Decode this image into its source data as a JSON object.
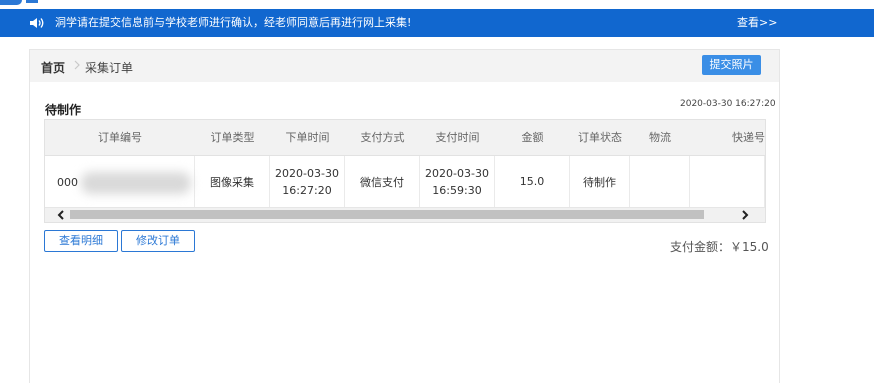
{
  "notice": {
    "message": "洞学请在提交信息前与学校老师进行确认，经老师同意后再进行网上采集!",
    "view_link": "查看>>"
  },
  "breadcrumb": {
    "home": "首页",
    "current": "采集订单"
  },
  "actions": {
    "submit_photo": "提交照片",
    "view_detail": "查看明细",
    "modify_order": "修改订单"
  },
  "order": {
    "status_title": "待制作",
    "timestamp": "2020-03-30 16:27:20",
    "columns": [
      "订单编号",
      "订单类型",
      "下单时间",
      "支付方式",
      "支付时间",
      "金额",
      "订单状态",
      "物流",
      "快递号"
    ],
    "row": {
      "order_no_visible": "000",
      "type": "图像采集",
      "order_date": "2020-03-30",
      "order_time": "16:27:20",
      "pay_method": "微信支付",
      "pay_date": "2020-03-30",
      "pay_time": "16:59:30",
      "amount": "15.0",
      "status": "待制作",
      "logistics": "",
      "tracking": ""
    },
    "pay_total": "支付金额：￥15.0"
  },
  "colors": {
    "notice_bar": "#1167cf",
    "button_blue": "#3a8ee6"
  }
}
